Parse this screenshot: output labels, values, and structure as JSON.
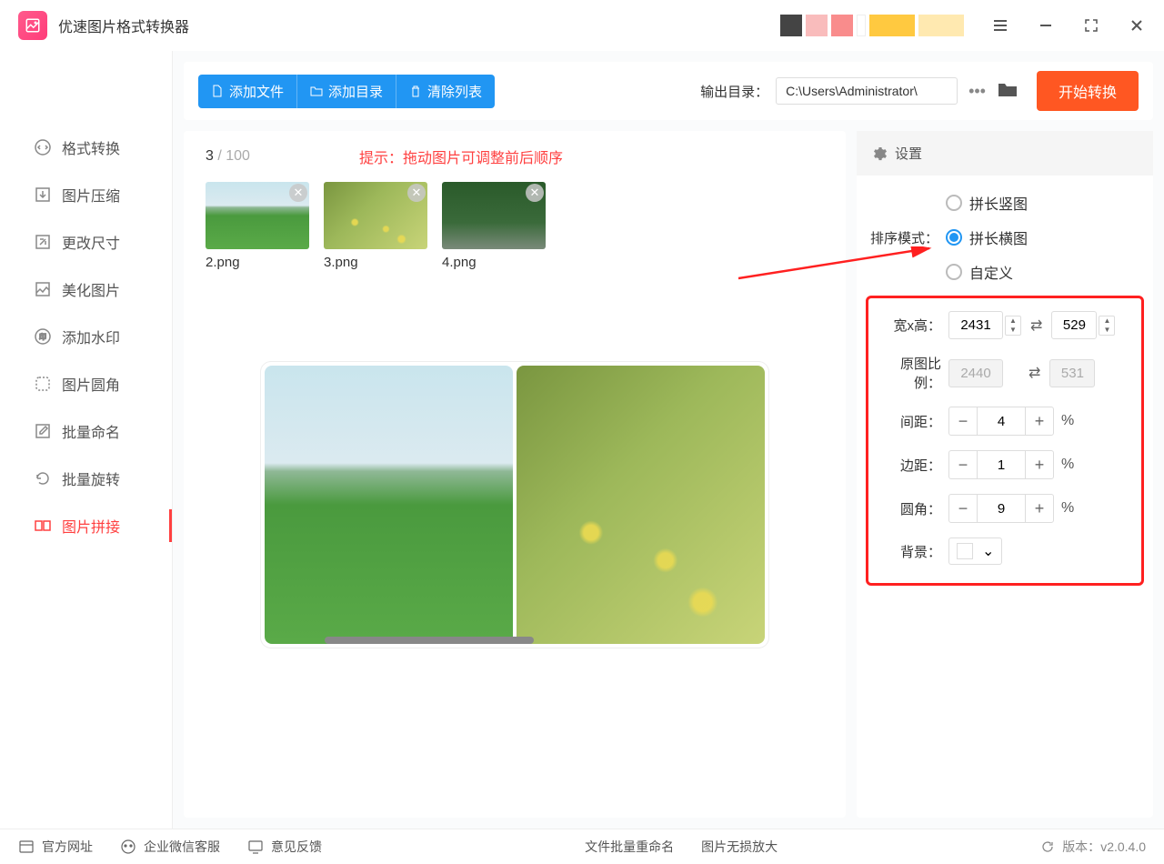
{
  "app": {
    "title": "优速图片格式转换器"
  },
  "window_controls": {
    "menu": "menu",
    "min": "minimize",
    "max": "fullscreen",
    "close": "close"
  },
  "sidebar": {
    "items": [
      {
        "label": "格式转换"
      },
      {
        "label": "图片压缩"
      },
      {
        "label": "更改尺寸"
      },
      {
        "label": "美化图片"
      },
      {
        "label": "添加水印"
      },
      {
        "label": "图片圆角"
      },
      {
        "label": "批量命名"
      },
      {
        "label": "批量旋转"
      },
      {
        "label": "图片拼接"
      }
    ],
    "active_index": 8
  },
  "toolbar": {
    "add_file": "添加文件",
    "add_folder": "添加目录",
    "clear_list": "清除列表",
    "output_label": "输出目录：",
    "output_path": "C:\\Users\\Administrator\\",
    "start": "开始转换"
  },
  "counter": {
    "current": "3",
    "sep": " / ",
    "total": "100"
  },
  "hint": "提示：拖动图片可调整前后顺序",
  "thumbs": [
    {
      "name": "2.png"
    },
    {
      "name": "3.png"
    },
    {
      "name": "4.png"
    }
  ],
  "settings": {
    "title": "设置",
    "sort_mode_label": "排序模式：",
    "modes": [
      {
        "label": "拼长竖图",
        "selected": false
      },
      {
        "label": "拼长横图",
        "selected": true
      },
      {
        "label": "自定义",
        "selected": false
      }
    ],
    "wh_label": "宽x高：",
    "width": "2431",
    "height": "529",
    "ratio_label": "原图比例：",
    "ratio_w": "2440",
    "ratio_h": "531",
    "spacing_label": "间距：",
    "spacing": "4",
    "margin_label": "边距：",
    "margin": "1",
    "radius_label": "圆角：",
    "radius": "9",
    "bg_label": "背景："
  },
  "footer": {
    "site": "官方网址",
    "support": "企业微信客服",
    "feedback": "意见反馈",
    "rename": "文件批量重命名",
    "lossless": "图片无损放大",
    "version_label": "版本：",
    "version": "v2.0.4.0"
  }
}
